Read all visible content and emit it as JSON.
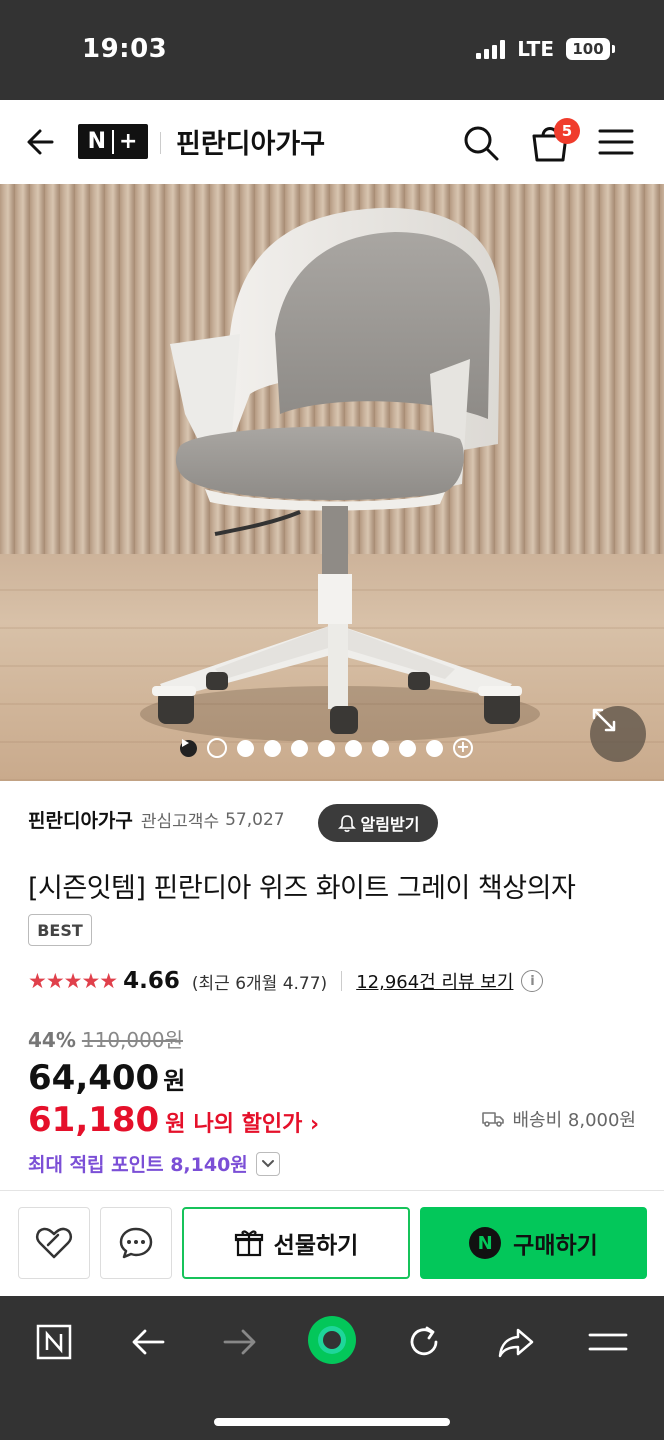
{
  "status_bar": {
    "time": "19:03",
    "network": "LTE",
    "battery": "100"
  },
  "navbar": {
    "logo_left": "N",
    "logo_right": "+",
    "store_name": "핀란디아가구",
    "cart_count": "5"
  },
  "gallery": {
    "total_dots": 10,
    "active_index": 0
  },
  "store": {
    "name": "핀란디아가구",
    "followers_label": "관심고객수",
    "followers_count": "57,027",
    "alarm_button": "알림받기"
  },
  "product": {
    "title": "[시즌잇템] 핀란디아 위즈 화이트 그레이 책상의자",
    "badge": "BEST",
    "rating": {
      "stars": "★★★★★",
      "score": "4.66",
      "recent": "(최근 6개월 4.77)",
      "review_link": "12,964건 리뷰 보기"
    },
    "price": {
      "discount_pct": "44%",
      "original": "110,000원",
      "current": "64,400",
      "currency": "원",
      "my_price": "61,180",
      "my_unit": "원",
      "my_label": "나의 할인가 ›"
    },
    "shipping": "배송비 8,000원",
    "points": "최대 적립 포인트 8,140원"
  },
  "actions": {
    "gift_label": "선물하기",
    "buy_label": "구매하기",
    "buy_badge": "N"
  },
  "colors": {
    "naver_green": "#03c75a",
    "price_red": "#e5102a",
    "points_purple": "#7b4fd6",
    "star_red": "#e0404b",
    "dark_bar": "#333333"
  }
}
